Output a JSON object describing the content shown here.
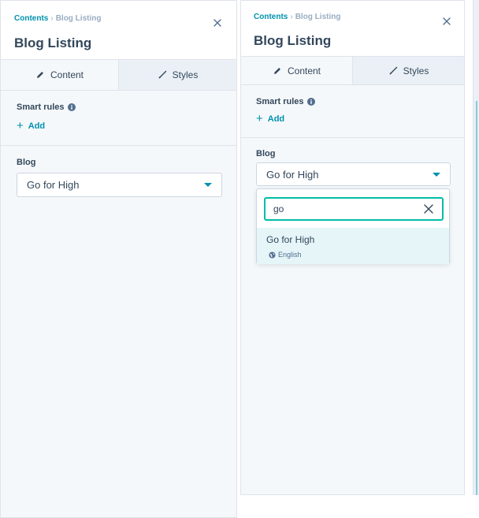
{
  "left_panel": {
    "breadcrumb": {
      "parent": "Contents",
      "separator": "›",
      "current": "Blog Listing"
    },
    "title": "Blog Listing",
    "tabs": [
      {
        "label": "Content",
        "active": true
      },
      {
        "label": "Styles",
        "active": false
      }
    ],
    "smart_rules": {
      "label": "Smart rules",
      "add_label": "Add"
    },
    "blog": {
      "label": "Blog",
      "selected": "Go for High"
    }
  },
  "right_panel": {
    "breadcrumb": {
      "parent": "Contents",
      "separator": "›",
      "current": "Blog Listing"
    },
    "title": "Blog Listing",
    "tabs": [
      {
        "label": "Content",
        "active": true
      },
      {
        "label": "Styles",
        "active": false
      }
    ],
    "smart_rules": {
      "label": "Smart rules",
      "add_label": "Add"
    },
    "blog": {
      "label": "Blog",
      "selected": "Go for High",
      "dropdown": {
        "search_value": "go",
        "options": [
          {
            "label": "Go for High",
            "language": "English"
          }
        ]
      }
    }
  },
  "icons": {
    "close": "close-icon",
    "pencil": "pencil-icon",
    "brush": "brush-icon",
    "info": "info-icon",
    "plus": "plus-icon",
    "caret": "chevron-down-icon",
    "clear": "clear-icon",
    "globe": "globe-icon"
  },
  "colors": {
    "accent": "#0091ae",
    "focus": "#00bda5",
    "text": "#33475b",
    "muted": "#99acc2",
    "panel_bg": "#f5f8fa",
    "option_highlight": "#e5f5f8"
  }
}
